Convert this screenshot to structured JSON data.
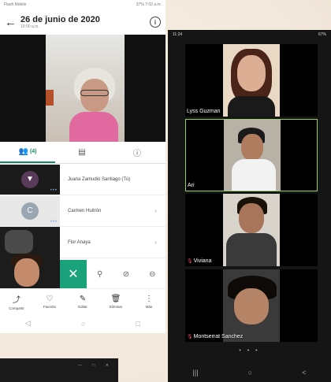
{
  "left": {
    "status": {
      "carrier": "Flash Mobile",
      "right": "37% 7:02 a.m."
    },
    "header": {
      "title": "26 de junio de 2020",
      "subtitle": "10:00 a.m."
    },
    "tabs": [
      {
        "label": "(4)",
        "icon": "people-icon"
      },
      {
        "label": "",
        "icon": "chat-icon"
      },
      {
        "label": "",
        "icon": "info-icon"
      }
    ],
    "participants": [
      {
        "name": "Juana Zamudio Santiago (Tú)",
        "avatar": "pin"
      },
      {
        "name": "Carmen Huitrón",
        "avatar": "C"
      },
      {
        "name": "Flor Anaya",
        "avatar": "video"
      }
    ],
    "tools": [
      {
        "label": "Compartir",
        "icon": "share-icon"
      },
      {
        "label": "Favorito",
        "icon": "heart-icon"
      },
      {
        "label": "Editar",
        "icon": "pencil-icon"
      },
      {
        "label": "Eliminar",
        "icon": "trash-icon"
      },
      {
        "label": "Más",
        "icon": "more-icon"
      }
    ],
    "nav": [
      "◁",
      "○",
      "□"
    ]
  },
  "right": {
    "status": {
      "time": "11:24",
      "right": "67%"
    },
    "tiles": [
      {
        "name": "Lyss Guzman",
        "muted": false
      },
      {
        "name": "Ari",
        "muted": false
      },
      {
        "name": "Viviana",
        "muted": true
      },
      {
        "name": "Montserrat Sanchez",
        "muted": true
      }
    ],
    "pager": "• • •",
    "nav": [
      "|||",
      "○",
      "<"
    ]
  },
  "colors": {
    "accent": "#1aa37a",
    "active_border": "#9bd066"
  }
}
